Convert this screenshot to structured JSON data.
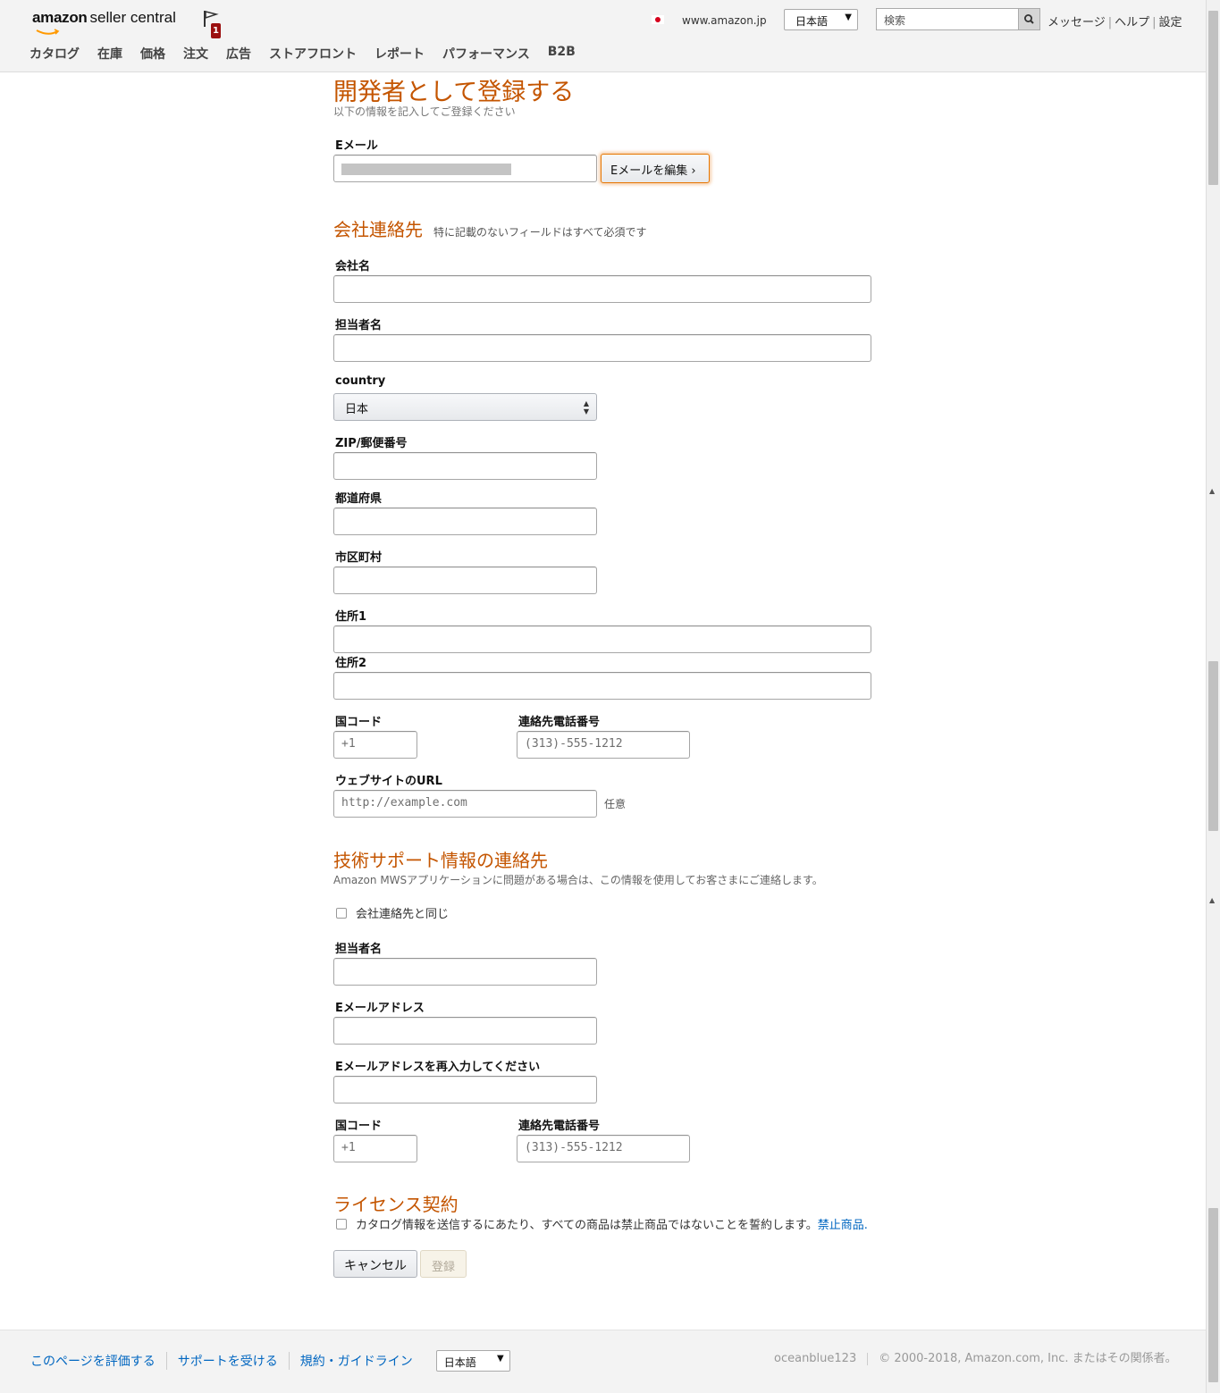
{
  "header": {
    "logo_text_bold": "amazon",
    "logo_text": "seller central",
    "notification_count": "1",
    "marketplace": "www.amazon.jp",
    "language": "日本語",
    "search_placeholder": "検索",
    "links": [
      "メッセージ",
      "ヘルプ",
      "設定"
    ],
    "nav": [
      "カタログ",
      "在庫",
      "価格",
      "注文",
      "広告",
      "ストアフロント",
      "レポート",
      "パフォーマンス",
      "B2B"
    ]
  },
  "form": {
    "title": "開発者として登録する",
    "subtitle": "以下の情報を記入してご登録ください",
    "email_label": "Eメール",
    "edit_email_button": "Eメールを編集 ›",
    "company": {
      "title": "会社連絡先",
      "note": "特に記載のないフィールドはすべて必須です",
      "company_name_label": "会社名",
      "contact_name_label": "担当者名",
      "country_label": "country",
      "country_value": "日本",
      "zip_label": "ZIP/郵便番号",
      "prefecture_label": "都道府県",
      "city_label": "市区町村",
      "address1_label": "住所1",
      "address2_label": "住所2",
      "country_code_label": "国コード",
      "country_code_placeholder": "+1",
      "phone_label": "連絡先電話番号",
      "phone_placeholder": "(313)-555-1212",
      "website_label": "ウェブサイトのURL",
      "website_placeholder": "http://example.com",
      "optional_text": "任意"
    },
    "tech": {
      "title": "技術サポート情報の連絡先",
      "subtitle": "Amazon MWSアプリケーションに問題がある場合は、この情報を使用してお客さまにご連絡します。",
      "same_as_company": "会社連絡先と同じ",
      "contact_name_label": "担当者名",
      "email_label": "Eメールアドレス",
      "email_confirm_label": "Eメールアドレスを再入力してください",
      "country_code_label": "国コード",
      "country_code_placeholder": "+1",
      "phone_label": "連絡先電話番号",
      "phone_placeholder": "(313)-555-1212"
    },
    "license": {
      "title": "ライセンス契約",
      "agreement_text": "カタログ情報を送信するにあたり、すべての商品は禁止商品ではないことを誓約します。",
      "link_text": "禁止商品."
    },
    "cancel_button": "キャンセル",
    "submit_button": "登録"
  },
  "footer": {
    "links": [
      "このページを評価する",
      "サポートを受ける",
      "規約・ガイドライン"
    ],
    "language": "日本語",
    "username": "oceanblue123",
    "copyright": "© 2000-2018, Amazon.com, Inc. またはその関係者。"
  },
  "colors": {
    "accent_orange": "#c45500",
    "link_blue": "#0066c0",
    "focus_orange": "#e77600"
  }
}
